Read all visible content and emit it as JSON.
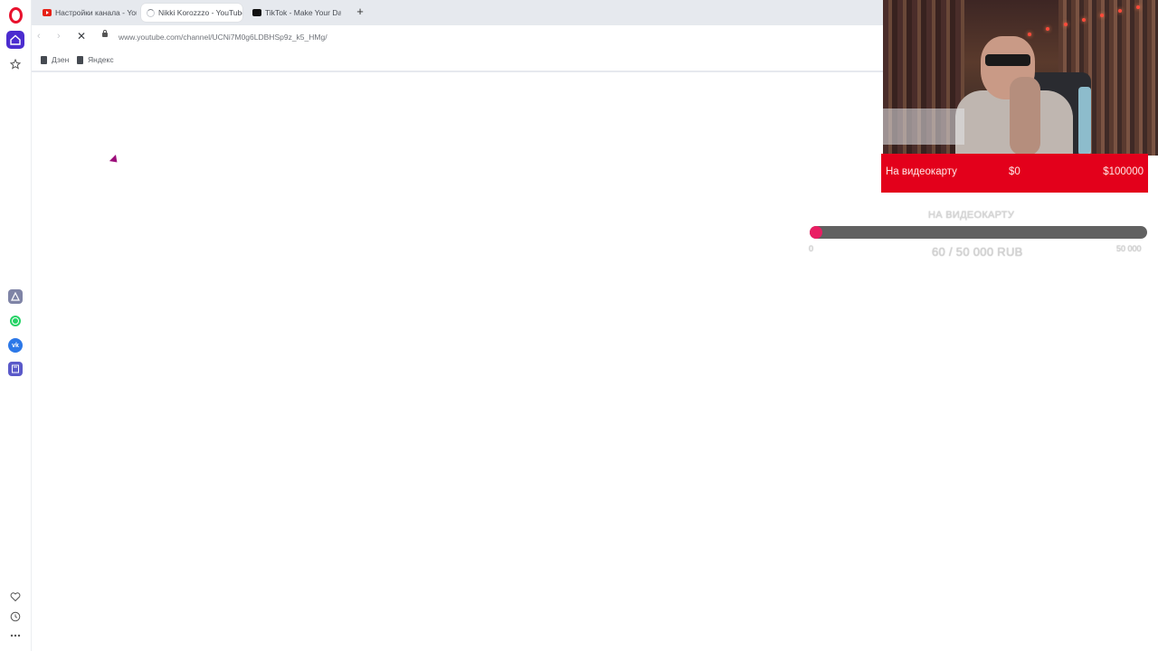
{
  "browser": {
    "tabs": [
      {
        "title": "Настройки канала - YouT",
        "favicon": "youtube-icon",
        "active": false
      },
      {
        "title": "Nikki Korozzzo - YouTube",
        "favicon": "loading-spinner-icon",
        "active": true
      },
      {
        "title": "TikTok - Make Your Day",
        "favicon": "tiktok-icon",
        "active": false
      }
    ],
    "new_tab_label": "+",
    "url": "www.youtube.com/channel/UCNi7M0g6LDBHSp9z_k5_HMg/",
    "bookmarks": [
      {
        "label": "Дзен"
      },
      {
        "label": "Яндекс"
      }
    ]
  },
  "sidebar": {
    "items": [
      "opera-logo-icon",
      "home-icon",
      "star-icon",
      "aria-icon",
      "whatsapp-icon",
      "vk-icon",
      "calculator-icon",
      "heart-icon",
      "history-icon",
      "more-icon"
    ]
  },
  "overlay": {
    "donation_bar": {
      "label": "На видеокарту",
      "current": "$0",
      "goal": "$100000",
      "color": "#e3001b"
    },
    "goal_widget": {
      "title": "НА ВИДЕОКАРТУ",
      "amount_text": "60 / 50 000 RUB",
      "min_label": "0",
      "max_label": "50 000",
      "progress_fraction": 0.0012,
      "fill_color": "#e91e63"
    }
  }
}
